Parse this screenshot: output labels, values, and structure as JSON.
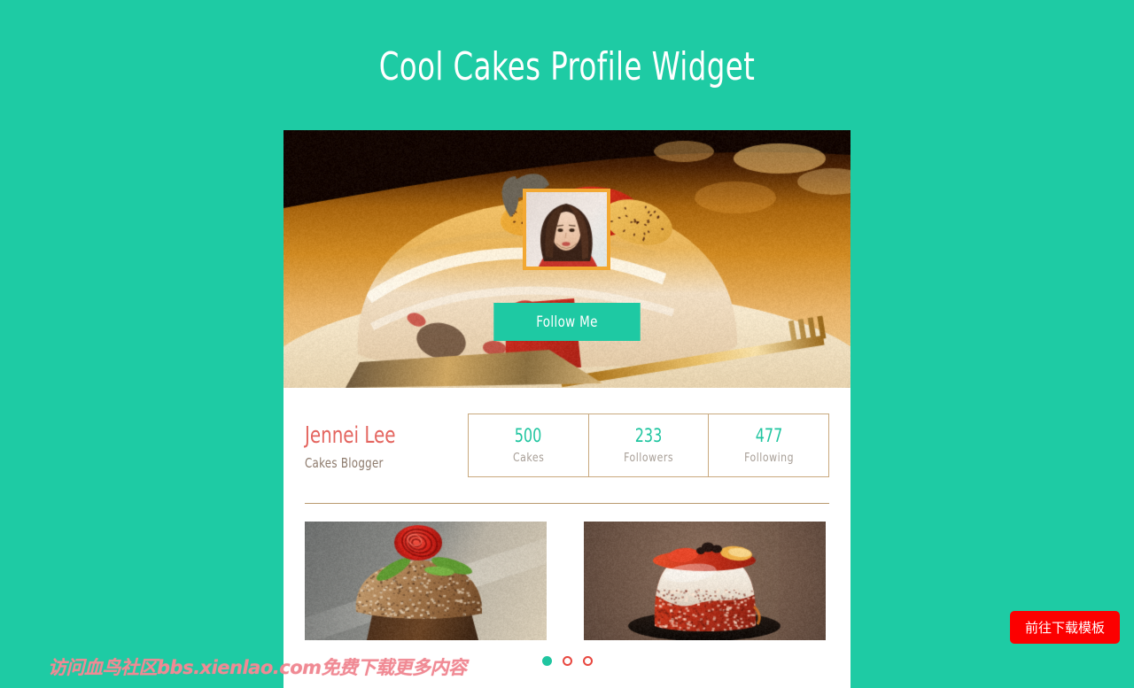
{
  "page": {
    "title": "Cool Cakes Profile Widget",
    "background_color": "#1ecba4"
  },
  "widget": {
    "cover": {
      "alt": "strawberry-cream-cake-roll-on-white-plate",
      "image_name": "cover-cake-photo"
    },
    "avatar": {
      "alt": "portrait-of-young-woman-with-long-brown-hair",
      "border_color": "#f2a833"
    },
    "follow_button": {
      "label": "Follow Me",
      "background_color": "#1ec9a3",
      "text_color": "#ffffff"
    },
    "identity": {
      "name": "Jennei Lee",
      "name_color": "#e4655f",
      "role": "Cakes Blogger",
      "role_color": "#8d7a6c"
    },
    "stats": [
      {
        "value": "500",
        "label": "Cakes"
      },
      {
        "value": "233",
        "label": "Followers"
      },
      {
        "value": "477",
        "label": "Following"
      }
    ],
    "stats_value_color": "#20c5a0",
    "stats_label_color": "#a79e96",
    "stats_border_color": "#c9a97e",
    "gallery": [
      {
        "alt": "chocolate-muffin-with-red-rose-decoration"
      },
      {
        "alt": "red-velvet-cake-with-white-frosting-and-berries"
      }
    ],
    "pagination": {
      "dots": 3,
      "active_index": 0,
      "active_color": "#20c5a0",
      "inactive_color": "#e8473f"
    }
  },
  "overlay": {
    "watermark": "访问血鸟社区bbs.xienlao.com免费下载更多内容",
    "watermark_color": "#f08a94",
    "cta_label": "前往下载模板",
    "cta_color": "#fc0000"
  }
}
